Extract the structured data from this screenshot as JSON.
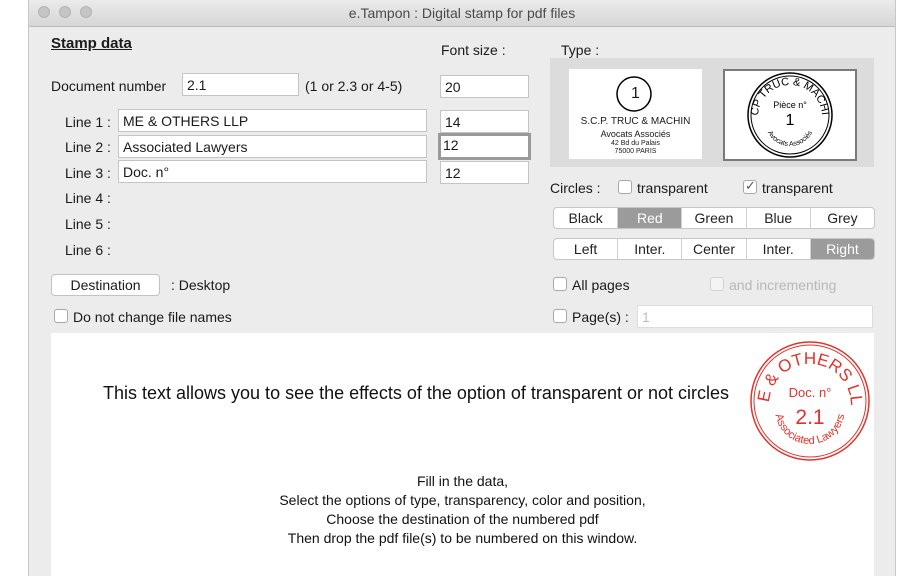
{
  "window": {
    "title": "e.Tampon : Digital stamp for pdf files"
  },
  "stamp": {
    "heading": "Stamp data",
    "font_size_label": "Font size :",
    "doc_number_label": "Document number",
    "doc_number_value": "2.1",
    "doc_number_hint": "(1 or 2.3 or 4-5)",
    "doc_number_font": "20",
    "lines": [
      {
        "label": "Line 1 :",
        "value": "ME & OTHERS LLP",
        "font": "14"
      },
      {
        "label": "Line 2 :",
        "value": "Associated Lawyers",
        "font": "12"
      },
      {
        "label": "Line 3 :",
        "value": "Doc. n°",
        "font": "12"
      },
      {
        "label": "Line 4 :"
      },
      {
        "label": "Line 5 :"
      },
      {
        "label": "Line 6 :"
      }
    ]
  },
  "destination": {
    "button": "Destination",
    "value": ": Desktop"
  },
  "keep_names": {
    "label": "Do not change file names",
    "checked": false
  },
  "type": {
    "label": "Type :",
    "rect": {
      "number": "1",
      "line1": "S.C.P. TRUC & MACHIN",
      "line2": "Avocats Associés",
      "line3": "42 Bd du Palais",
      "line4": "75000 PARIS"
    },
    "circle": {
      "top": "SCP TRUC & MACHIN",
      "label": "Pièce n°",
      "number": "1",
      "bottom": "Avocats Associés"
    }
  },
  "circles": {
    "label": "Circles :",
    "opt1": "transparent",
    "opt1_checked": false,
    "opt2": "transparent",
    "opt2_checked": true
  },
  "colors": {
    "items": [
      "Black",
      "Red",
      "Green",
      "Blue",
      "Grey"
    ],
    "selected": "Red"
  },
  "positions": {
    "items": [
      "Left",
      "Inter.",
      "Center",
      "Inter.",
      "Right"
    ],
    "selected": "Right"
  },
  "pages": {
    "all_label": "All pages",
    "incrementing_label": "and incrementing",
    "pages_label": "Page(s) :",
    "pages_value": "1"
  },
  "preview": {
    "sample_text": "This text allows you to see the effects of the option of transparent or not circles",
    "stamp_top": "ME & OTHERS LLP",
    "stamp_label": "Doc. n°",
    "stamp_number": "2.1",
    "stamp_bottom": "Associated Lawyers",
    "stamp_color": "#e0332b",
    "instructions": [
      "Fill in the data,",
      "Select the options of type, transparency, color and position,",
      "Choose the destination of the numbered pdf",
      "Then drop the pdf file(s) to be numbered on this window."
    ]
  }
}
